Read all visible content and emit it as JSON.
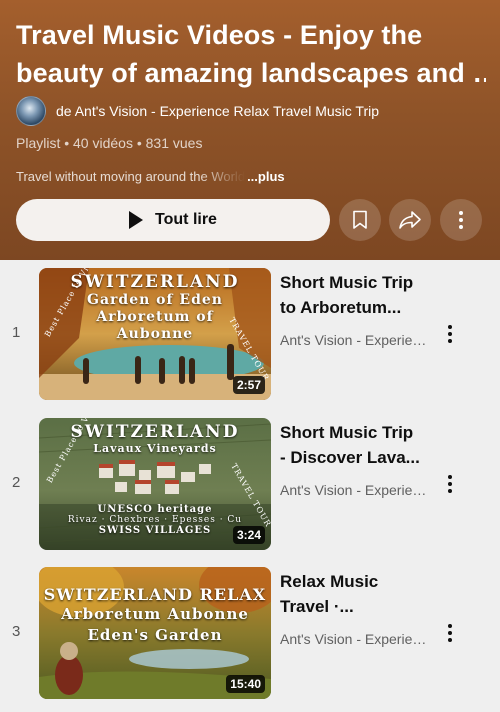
{
  "playlist": {
    "title_line1": "Travel Music Videos - Enjoy the",
    "title_line2": "beauty of amazing landscapes and …",
    "channel": "de Ant's Vision - Experience Relax Travel Music Trip",
    "meta": "Playlist • 40 vidéos • 831 vues",
    "description": "Travel without moving around the World",
    "more_label": "...plus",
    "play_all_label": "Tout lire",
    "save_icon": "bookmark-icon",
    "share_icon": "share-icon",
    "menu_icon": "more-vert-icon"
  },
  "videos": [
    {
      "index": "1",
      "title_line1": "Short Music Trip",
      "title_line2": "to Arboretum...",
      "channel": "Ant's Vision - Experience Relax Travel Music Trip",
      "duration": "2:57",
      "thumb_text": [
        "SWITZERLAND",
        "Garden of Eden",
        "Arboretum of",
        "Aubonne"
      ],
      "thumb_side_left": "Best Place to Visit",
      "thumb_side_right": "TRAVEL TOUR"
    },
    {
      "index": "2",
      "title_line1": "Short Music Trip",
      "title_line2": "- Discover Lava...",
      "channel": "Ant's Vision - Experience Relax Travel Music Trip",
      "duration": "3:24",
      "thumb_text": [
        "SWITZERLAND",
        "Lavaux Vineyards",
        "UNESCO heritage",
        "Rivaz · Chexbres · Epesses · Cu",
        "SWISS VILLAGES"
      ],
      "thumb_side_left": "Best Place to Visit",
      "thumb_side_right": "TRAVEL TOUR"
    },
    {
      "index": "3",
      "title_line1": "Relax Music",
      "title_line2": "Travel ·...",
      "channel": "Ant's Vision - Experience Relax Travel Music Trip",
      "duration": "15:40",
      "thumb_text": [
        "SWITZERLAND RELAX",
        "Arboretum Aubonne",
        "Eden's Garden"
      ]
    }
  ]
}
